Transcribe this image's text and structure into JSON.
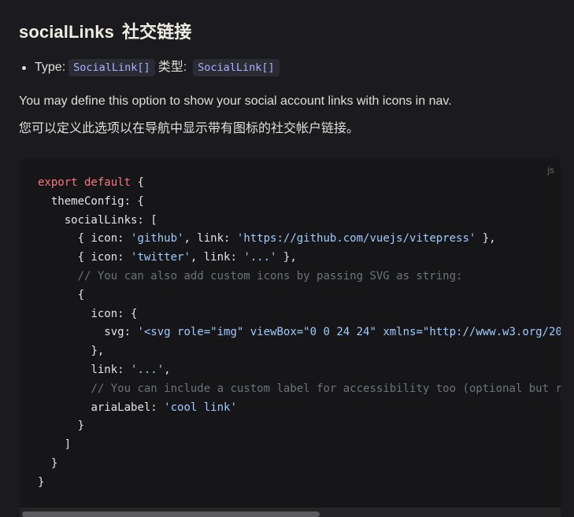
{
  "heading": {
    "en": "socialLinks",
    "zh": "社交链接"
  },
  "type_line": {
    "label": "Type:",
    "type_code": "SocialLink[]",
    "zh_label": "类型:",
    "zh_type_code": "SocialLink[]"
  },
  "description": {
    "en": "You may define this option to show your social account links with icons in nav.",
    "zh": "您可以定义此选项以在导航中显示带有图标的社交帐户链接。"
  },
  "code_block": {
    "language": "js",
    "lines": [
      {
        "indent": "",
        "parts": [
          {
            "k": "kw",
            "t": "export default"
          },
          {
            "k": "pl",
            "t": " {"
          }
        ]
      },
      {
        "indent": "  ",
        "parts": [
          {
            "k": "pl",
            "t": "themeConfig: {"
          }
        ]
      },
      {
        "indent": "    ",
        "parts": [
          {
            "k": "pl",
            "t": "socialLinks: ["
          }
        ]
      },
      {
        "indent": "      ",
        "parts": [
          {
            "k": "pl",
            "t": "{ icon: "
          },
          {
            "k": "str",
            "t": "'github'"
          },
          {
            "k": "pl",
            "t": ", link: "
          },
          {
            "k": "str",
            "t": "'https://github.com/vuejs/vitepress'"
          },
          {
            "k": "pl",
            "t": " },"
          }
        ]
      },
      {
        "indent": "      ",
        "parts": [
          {
            "k": "pl",
            "t": "{ icon: "
          },
          {
            "k": "str",
            "t": "'twitter'"
          },
          {
            "k": "pl",
            "t": ", link: "
          },
          {
            "k": "str",
            "t": "'...'"
          },
          {
            "k": "pl",
            "t": " },"
          }
        ]
      },
      {
        "indent": "      ",
        "parts": [
          {
            "k": "cm",
            "t": "// You can also add custom icons by passing SVG as string:"
          }
        ]
      },
      {
        "indent": "      ",
        "parts": [
          {
            "k": "pl",
            "t": "{"
          }
        ]
      },
      {
        "indent": "        ",
        "parts": [
          {
            "k": "pl",
            "t": "icon: {"
          }
        ]
      },
      {
        "indent": "          ",
        "parts": [
          {
            "k": "pl",
            "t": "svg: "
          },
          {
            "k": "str",
            "t": "'<svg role=\"img\" viewBox=\"0 0 24 24\" xmlns=\"http://www.w3.org/20"
          }
        ]
      },
      {
        "indent": "        ",
        "parts": [
          {
            "k": "pl",
            "t": "},"
          }
        ]
      },
      {
        "indent": "        ",
        "parts": [
          {
            "k": "pl",
            "t": "link: "
          },
          {
            "k": "str",
            "t": "'...'"
          },
          {
            "k": "pl",
            "t": ","
          }
        ]
      },
      {
        "indent": "        ",
        "parts": [
          {
            "k": "cm",
            "t": "// You can include a custom label for accessibility too (optional but r"
          }
        ]
      },
      {
        "indent": "        ",
        "parts": [
          {
            "k": "pl",
            "t": "ariaLabel: "
          },
          {
            "k": "str",
            "t": "'cool link'"
          }
        ]
      },
      {
        "indent": "      ",
        "parts": [
          {
            "k": "pl",
            "t": "}"
          }
        ]
      },
      {
        "indent": "    ",
        "parts": [
          {
            "k": "pl",
            "t": "]"
          }
        ]
      },
      {
        "indent": "  ",
        "parts": [
          {
            "k": "pl",
            "t": "}"
          }
        ]
      },
      {
        "indent": "",
        "parts": [
          {
            "k": "pl",
            "t": "}"
          }
        ]
      }
    ]
  },
  "colors": {
    "background": "#1b1b1f",
    "code_background": "#161618",
    "keyword": "#f97583",
    "string": "#9ecbff",
    "comment": "#6a737d",
    "inline_code": "#a8b1ff"
  },
  "scrollbar": {
    "horizontal_thumb_fraction": 0.55
  }
}
